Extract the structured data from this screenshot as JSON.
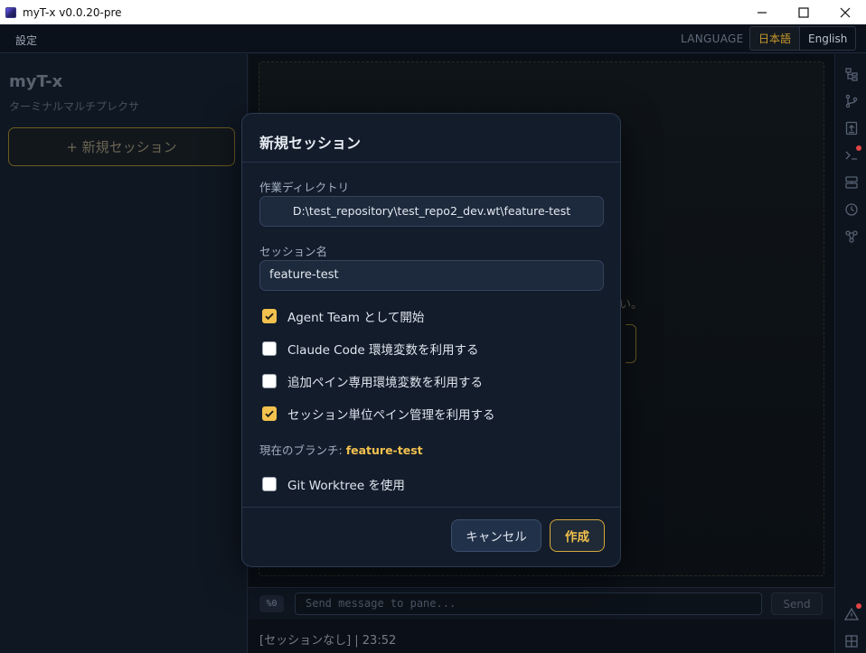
{
  "window": {
    "title": "myT-x v0.0.20-pre",
    "minimize_glyph": "—",
    "maximize_glyph": "☐",
    "close_glyph": "✕"
  },
  "menubar": {
    "settings_label": "設定",
    "language_label": "LANGUAGE",
    "lang_options": [
      "日本語",
      "English"
    ],
    "active_lang": "日本語"
  },
  "sidebar": {
    "brand": "myT-x",
    "subtitle": "ターミナルマルチプレクサ",
    "new_session_label": "+ 新規セッション"
  },
  "main": {
    "pane_hint_fragment": "い。",
    "pane_tag": "%0",
    "message_placeholder": "Send message to pane...",
    "send_label": "Send",
    "status": "[セッションなし] | 23:52"
  },
  "rail": {
    "icons": [
      "file-tree-icon",
      "git-branch-icon",
      "upload-icon",
      "terminal-icon",
      "layout-icon",
      "history-icon",
      "graph-icon",
      "warning-icon",
      "grid-icon"
    ]
  },
  "dialog": {
    "title": "新規セッション",
    "dir_label": "作業ディレクトリ",
    "dir_value": "D:\\test_repository\\test_repo2_dev.wt\\feature-test",
    "name_label": "セッション名",
    "name_value": "feature-test",
    "options": [
      {
        "label": "Agent Team として開始",
        "checked": true
      },
      {
        "label": "Claude Code 環境変数を利用する",
        "checked": false
      },
      {
        "label": "追加ペイン専用環境変数を利用する",
        "checked": false
      },
      {
        "label": "セッション単位ペイン管理を利用する",
        "checked": true
      }
    ],
    "branch_label": "現在のブランチ: ",
    "branch_value": "feature-test",
    "worktree": {
      "label": "Git Worktree を使用",
      "checked": false
    },
    "cancel_label": "キャンセル",
    "create_label": "作成"
  },
  "colors": {
    "accent": "#f2c14e",
    "dialog_bg": "#131c2b",
    "app_bg": "#0d1420"
  }
}
